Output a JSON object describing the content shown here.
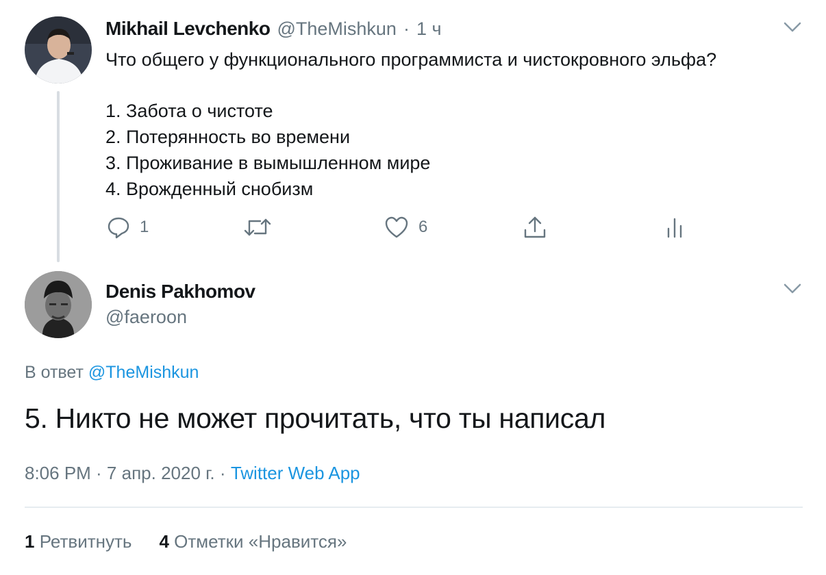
{
  "tweet1": {
    "author_name": "Mikhail Levchenko",
    "handle": "@TheMishkun",
    "separator": "·",
    "time": "1 ч",
    "text_question": "Что общего у функционального программиста и чистокровного эльфа?",
    "list": [
      "1. Забота о чистоте",
      "2. Потерянность во времени",
      "3. Проживание в вымышленном мире",
      "4. Врожденный снобизм"
    ],
    "reply_count": "1",
    "retweet_count": "",
    "like_count": "6"
  },
  "tweet2": {
    "author_name": "Denis Pakhomov",
    "handle": "@faeroon",
    "reply_prefix": "В ответ",
    "reply_to": "@TheMishkun",
    "text": "5. Никто не может прочитать, что ты написал",
    "timestamp": "8:06 PM · 7 апр. 2020 г.",
    "dot": "·",
    "source": "Twitter Web App",
    "retweets_count": "1",
    "retweets_label": "Ретвитнуть",
    "likes_count": "4",
    "likes_label": "Отметки «Нравится»"
  },
  "icons": {
    "reply": "reply-icon",
    "retweet": "retweet-icon",
    "like": "heart-icon",
    "share": "share-icon",
    "analytics": "analytics-icon",
    "menu": "chevron-down-icon"
  },
  "colors": {
    "link": "#1b95e0",
    "muted": "#66757f",
    "text": "#14171a",
    "thread_line": "#d8dde2"
  }
}
